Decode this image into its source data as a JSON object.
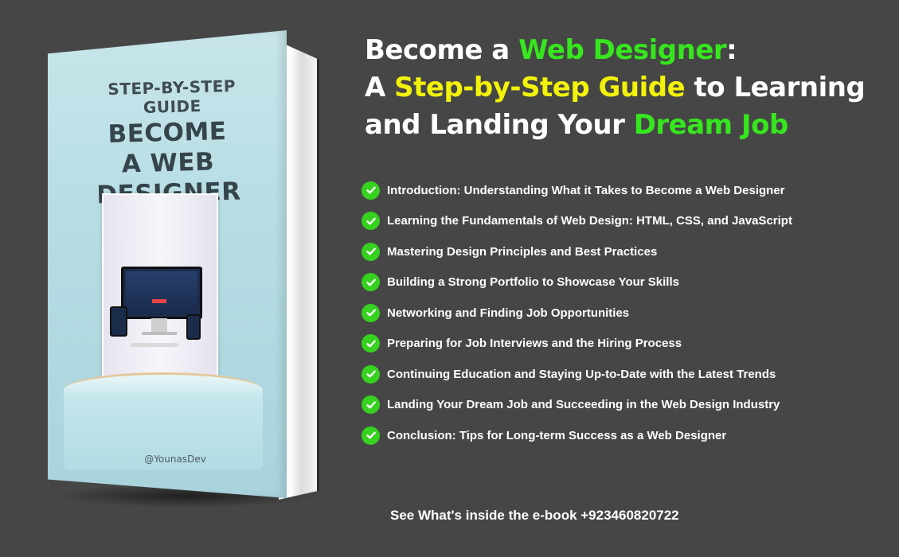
{
  "book": {
    "kicker": "STEP-BY-STEP GUIDE",
    "title_line1": "BECOME",
    "title_line2": "A WEB DESIGNER",
    "handle": "@YounasDev"
  },
  "headline": {
    "line1_a": "Become a ",
    "line1_b": "Web Designer",
    "line1_c": ":",
    "line2_a": "A ",
    "line2_b": "Step-by-Step Guide",
    "line2_c": " to Learning",
    "line3_a": "and Landing Your ",
    "line3_b": "Dream Job"
  },
  "topics": [
    "Introduction: Understanding What it Takes to Become a Web Designer",
    "Learning the Fundamentals of Web Design: HTML, CSS, and JavaScript",
    "Mastering Design Principles and Best Practices",
    "Building a Strong Portfolio to Showcase Your Skills",
    "Networking and Finding Job Opportunities",
    "Preparing for Job Interviews and the Hiring Process",
    "Continuing Education and Staying Up-to-Date with the Latest Trends",
    "Landing Your Dream Job and Succeeding in the Web Design Industry",
    "Conclusion: Tips for Long-term Success as a Web Designer"
  ],
  "footer": {
    "cta": "See What's inside the e-book +923460820722"
  },
  "colors": {
    "background": "#464646",
    "accent_green": "#36e61e",
    "accent_yellow": "#f2f20b",
    "check_green": "#36d21f"
  },
  "icons": {
    "topic_bullet": "check-circle-icon"
  }
}
